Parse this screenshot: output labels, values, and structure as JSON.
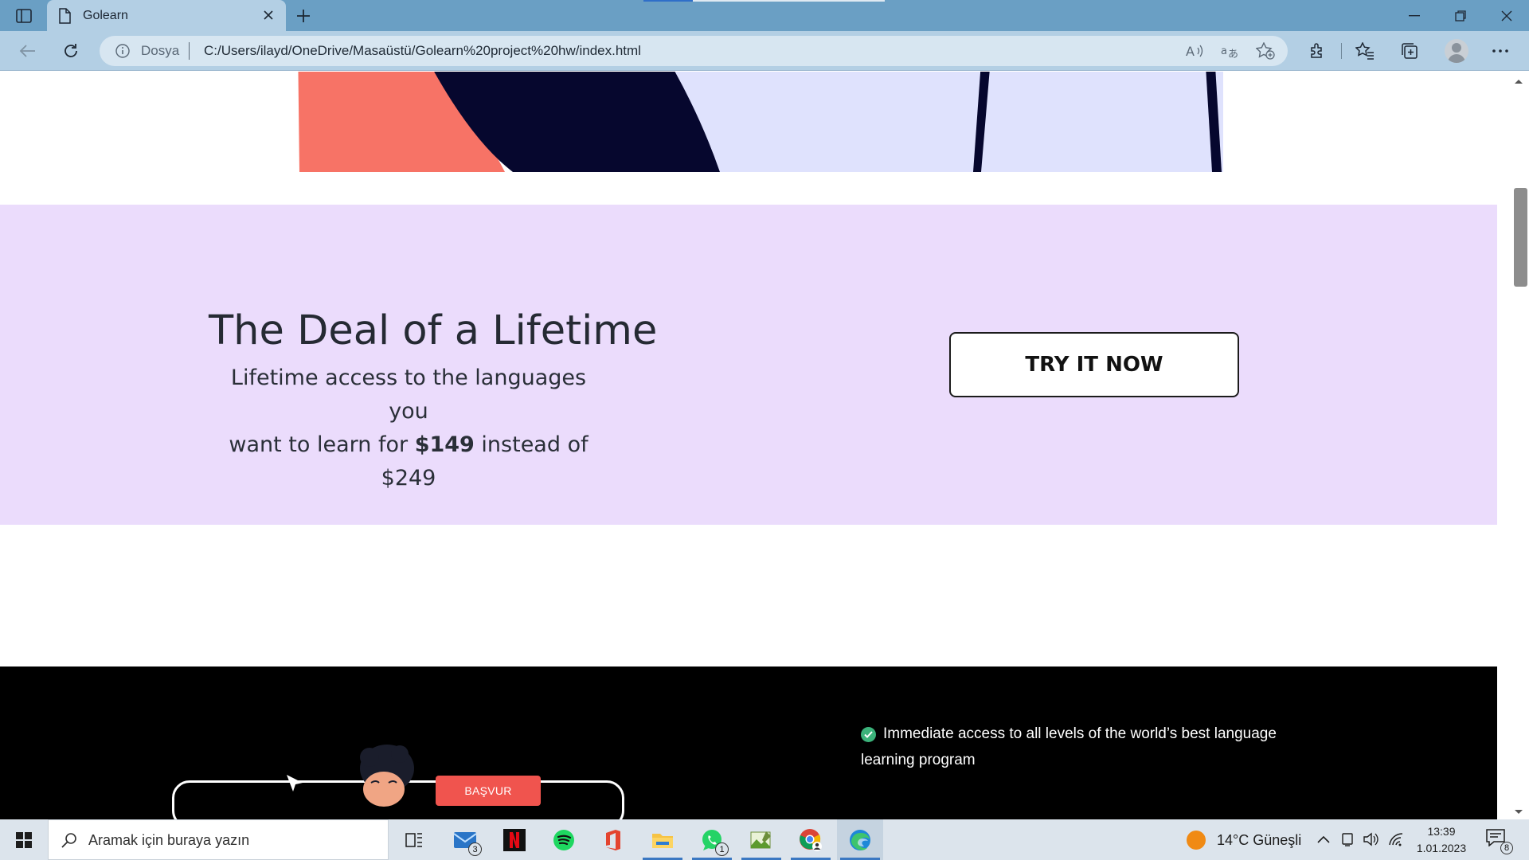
{
  "browser": {
    "tab_title": "Golearn",
    "address_scheme": "Dosya",
    "address_url": "C:/Users/ilayd/OneDrive/Masaüstü/Golearn%20project%20hw/index.html"
  },
  "deal": {
    "title": "The Deal of a Lifetime",
    "line1": "Lifetime access to the languages you",
    "line2_prefix": "want to learn for ",
    "price_new": "$149",
    "line2_suffix": " instead of $249",
    "cta_label": "TRY IT NOW",
    "background": "#ebdcfc"
  },
  "features": {
    "item1": "Immediate access to all levels of the world’s best language learning program",
    "check_color": "#3bb27a"
  },
  "promo": {
    "badge_label": "BAŞVUR",
    "badge_color": "#f0544e"
  },
  "taskbar": {
    "search_placeholder": "Aramak için buraya yazın",
    "mail_badge": "3",
    "whatsapp_badge": "1",
    "weather": "14°C  Güneşli",
    "time": "13:39",
    "date": "1.01.2023",
    "notifications": "8"
  }
}
